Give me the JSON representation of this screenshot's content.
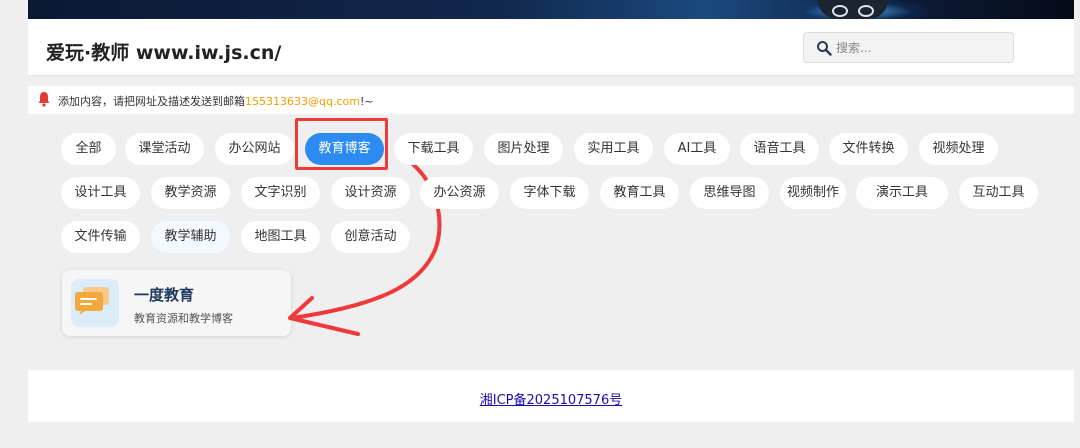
{
  "header": {
    "site_title": "爱玩·教师 www.iw.js.cn/",
    "search_placeholder": "搜索..."
  },
  "notice": {
    "text_before": "添加内容，请把网址及描述发送到邮箱",
    "email": "155313633@qq.com",
    "text_after": "!~"
  },
  "categories": [
    "全部",
    "课堂活动",
    "办公网站",
    "教育博客",
    "下载工具",
    "图片处理",
    "实用工具",
    "AI工具",
    "语音工具",
    "文件转换",
    "视频处理",
    "设计工具",
    "教学资源",
    "文字识别",
    "设计资源",
    "办公资源",
    "字体下载",
    "教育工具",
    "思维导图",
    "视频制作",
    "演示工具",
    "互动工具",
    "文件传输",
    "教学辅助",
    "地图工具",
    "创意活动"
  ],
  "active_category": "教育博客",
  "card": {
    "title": "一度教育",
    "description": "教育资源和教学博客",
    "icon": "chat-bubbles-icon"
  },
  "footer": {
    "icp": "湘ICP备2025107576号"
  },
  "colors": {
    "accent": "#2b8bf0",
    "annotation": "#ee3a3a",
    "email": "#f0a000"
  }
}
